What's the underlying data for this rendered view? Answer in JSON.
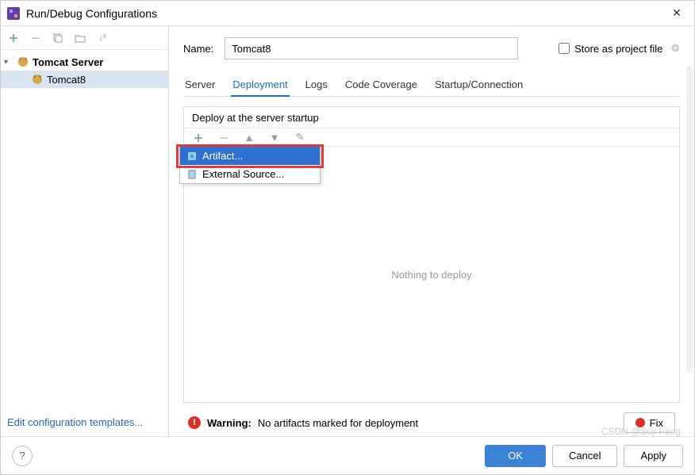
{
  "title": "Run/Debug Configurations",
  "sidebar": {
    "parent_label": "Tomcat Server",
    "child_label": "Tomcat8"
  },
  "edit_templates_link": "Edit configuration templates...",
  "name_label": "Name:",
  "name_value": "Tomcat8",
  "store_label": "Store as project file",
  "tabs": [
    "Server",
    "Deployment",
    "Logs",
    "Code Coverage",
    "Startup/Connection"
  ],
  "active_tab": 1,
  "deploy_header": "Deploy at the server startup",
  "popup": {
    "artifact": "Artifact...",
    "external": "External Source..."
  },
  "deploy_placeholder": "Nothing to deploy",
  "warning_label": "Warning:",
  "warning_text": "No artifacts marked for deployment",
  "fix_label": "Fix",
  "buttons": {
    "ok": "OK",
    "cancel": "Cancel",
    "apply": "Apply"
  },
  "watermark": "CSDN @Suji Feng"
}
